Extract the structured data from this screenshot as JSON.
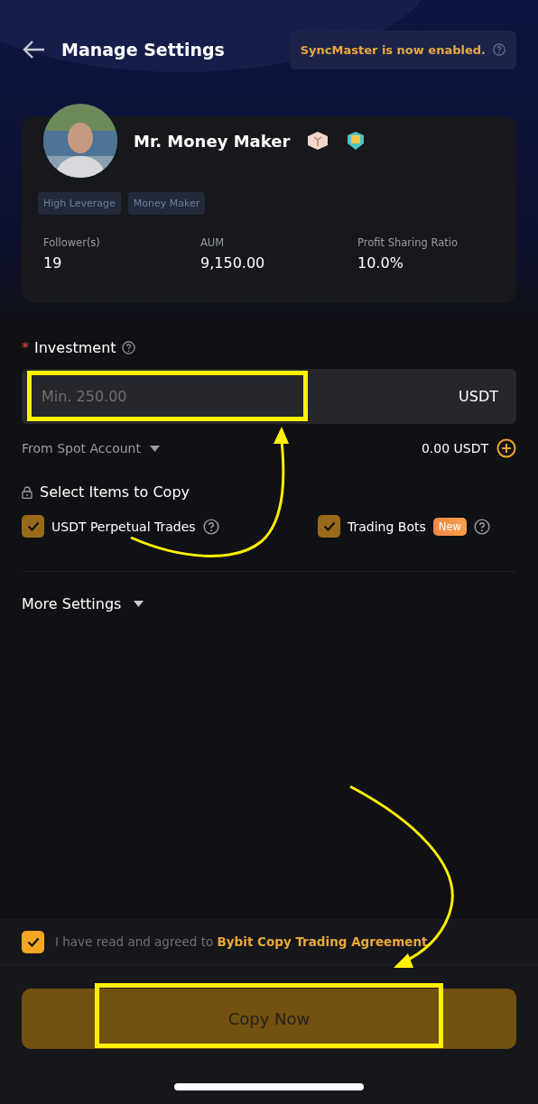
{
  "header": {
    "title": "Manage Settings"
  },
  "sync_notice": {
    "text": "SyncMaster is now enabled."
  },
  "trader": {
    "name": "Mr. Money Maker",
    "avatar": {
      "kind": "picture"
    },
    "tags": [
      "High Leverage",
      "Money Maker"
    ],
    "stats": [
      {
        "label": "Follower(s)",
        "value": "19"
      },
      {
        "label": "AUM",
        "value": "9,150.00"
      },
      {
        "label": "Profit Sharing Ratio",
        "value": "10.0%"
      }
    ]
  },
  "investment": {
    "required_mark": "*",
    "label": "Investment",
    "placeholder": "Min. 250.00",
    "unit": "USDT"
  },
  "source": {
    "label": "From Spot Account",
    "balance": "0.00 USDT"
  },
  "copy_items": {
    "title": "Select Items to Copy",
    "items": [
      {
        "label": "USDT Perpetual Trades",
        "checked": true,
        "disabled": true
      },
      {
        "label": "Trading Bots",
        "checked": true,
        "disabled": true,
        "badge": "New"
      }
    ]
  },
  "more_settings": {
    "label": "More Settings"
  },
  "agreement": {
    "checked": true,
    "text": "I have read and agreed to",
    "link": "Bybit Copy Trading Agreement"
  },
  "submit": {
    "label": "Copy Now",
    "disabled": true
  }
}
